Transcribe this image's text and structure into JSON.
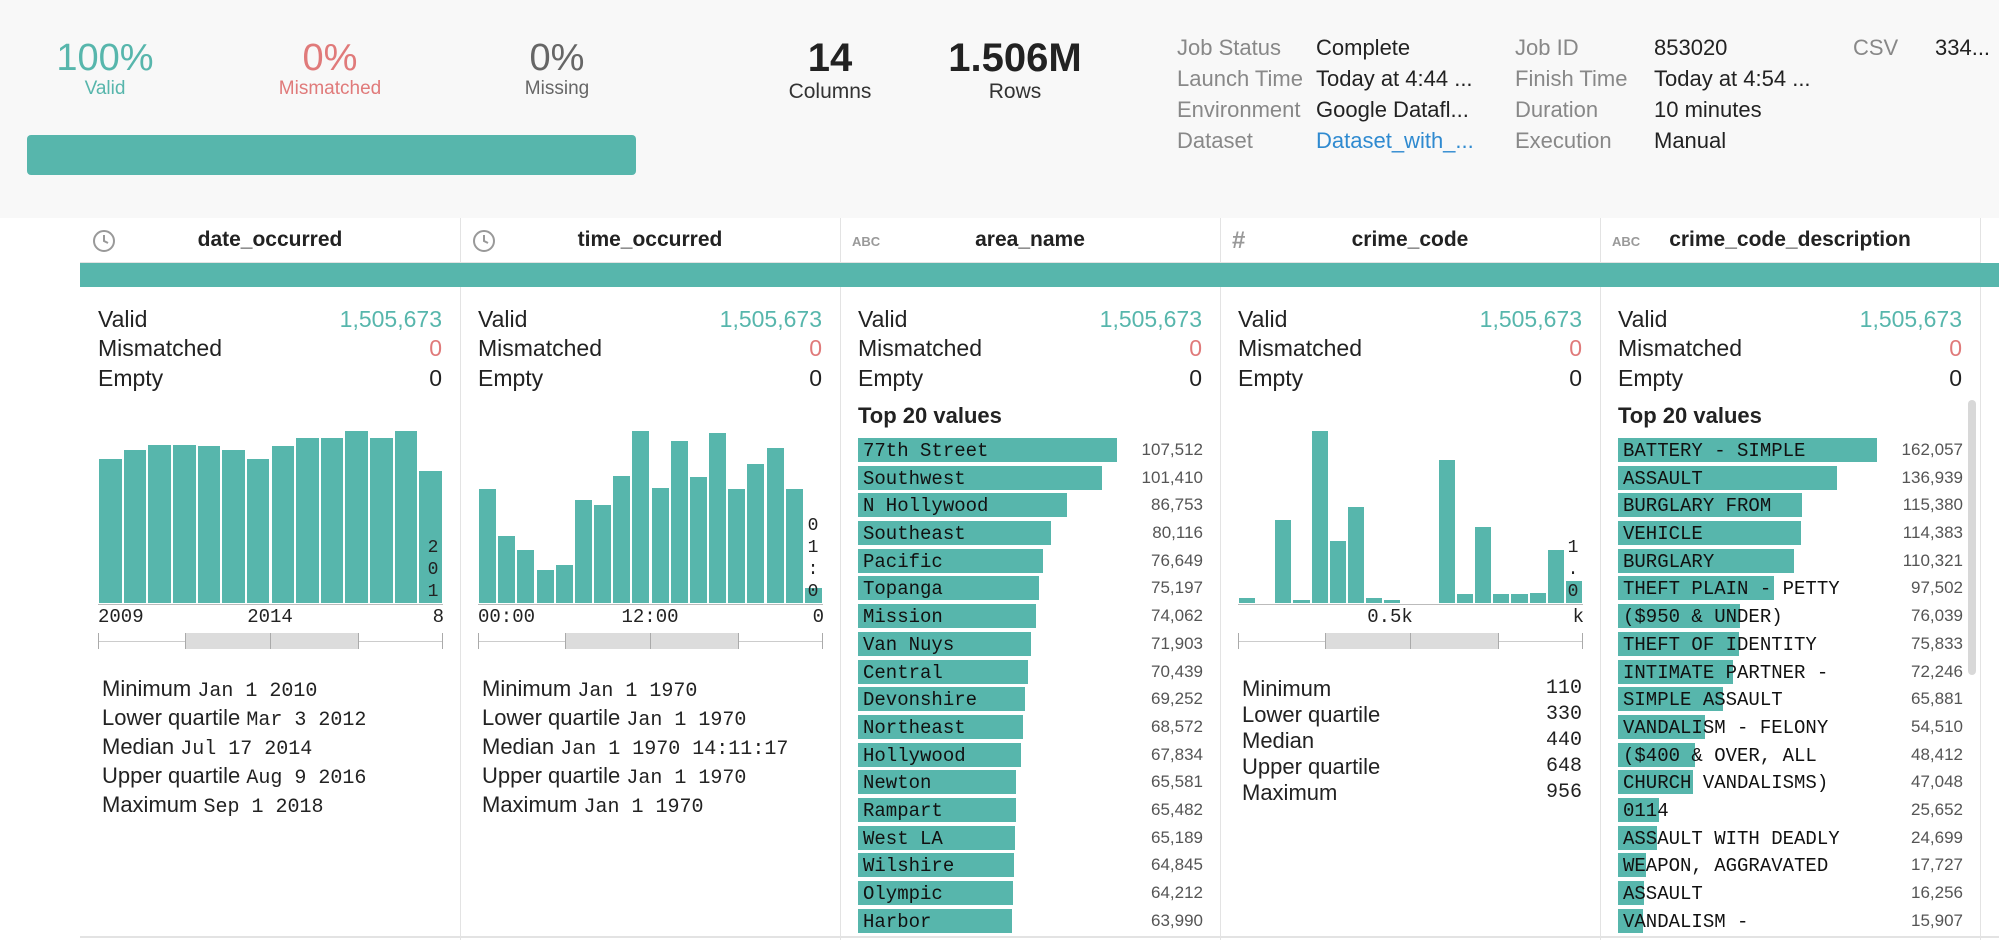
{
  "summary": {
    "valid": {
      "pct": "100%",
      "label": "Valid"
    },
    "mismatched": {
      "pct": "0%",
      "label": "Mismatched"
    },
    "missing": {
      "pct": "0%",
      "label": "Missing"
    },
    "valid_fraction": 1.0,
    "columns": {
      "value": "14",
      "label": "Columns"
    },
    "rows": {
      "value": "1.506M",
      "label": "Rows"
    }
  },
  "job": {
    "status_label": "Job Status",
    "status": "Complete",
    "launch_label": "Launch Time",
    "launch": "Today at 4:44 ...",
    "env_label": "Environment",
    "env": "Google Datafl...",
    "dataset_label": "Dataset",
    "dataset": "Dataset_with_...",
    "id_label": "Job ID",
    "id": "853020",
    "finish_label": "Finish Time",
    "finish": "Today at 4:54 ...",
    "duration_label": "Duration",
    "duration": "10 minutes",
    "execution_label": "Execution",
    "execution": "Manual",
    "csv_label": "CSV",
    "csv": "334..."
  },
  "labels": {
    "valid": "Valid",
    "mismatched": "Mismatched",
    "empty": "Empty",
    "top20": "Top 20 values",
    "min": "Minimum",
    "lq": "Lower quartile",
    "median": "Median",
    "uq": "Upper quartile",
    "max": "Maximum"
  },
  "columns": [
    {
      "name": "date_occurred",
      "type_icon": "clock-icon",
      "valid": "1,505,673",
      "mismatched": "0",
      "empty": "0",
      "hist": [
        0.84,
        0.89,
        0.92,
        0.92,
        0.91,
        0.89,
        0.84,
        0.91,
        0.96,
        0.96,
        1.0,
        0.96,
        1.0,
        0.77
      ],
      "ticks": [
        "2009",
        "2014",
        "8"
      ],
      "vlabel": [
        "2",
        "0",
        "1"
      ],
      "stats": {
        "min": "Jan 1 2010",
        "lq": "Mar 3 2012",
        "median": "Jul 17 2014",
        "uq": "Aug 9 2016",
        "max": "Sep 1 2018"
      }
    },
    {
      "name": "time_occurred",
      "type_icon": "clock-icon",
      "valid": "1,505,673",
      "mismatched": "0",
      "empty": "0",
      "hist": [
        0.66,
        0.39,
        0.31,
        0.19,
        0.22,
        0.6,
        0.57,
        0.74,
        1.0,
        0.67,
        0.94,
        0.73,
        0.99,
        0.66,
        0.81,
        0.9,
        0.66,
        0.09
      ],
      "ticks": [
        "00:00",
        "12:00",
        "0"
      ],
      "vlabel": [
        "0",
        "1",
        ":",
        "0"
      ],
      "stats": {
        "min": "Jan 1 1970",
        "lq": "Jan 1 1970",
        "median": "Jan 1 1970 14:11:17",
        "uq": "Jan 1 1970",
        "max": "Jan 1 1970"
      }
    },
    {
      "name": "area_name",
      "type_icon": "abc-icon",
      "valid": "1,505,673",
      "mismatched": "0",
      "empty": "0",
      "top": [
        [
          "77th Street",
          "107,512",
          107512
        ],
        [
          "Southwest",
          "101,410",
          101410
        ],
        [
          "N Hollywood",
          "86,753",
          86753
        ],
        [
          "Southeast",
          "80,116",
          80116
        ],
        [
          "Pacific",
          "76,649",
          76649
        ],
        [
          "Topanga",
          "75,197",
          75197
        ],
        [
          "Mission",
          "74,062",
          74062
        ],
        [
          "Van Nuys",
          "71,903",
          71903
        ],
        [
          "Central",
          "70,439",
          70439
        ],
        [
          "Devonshire",
          "69,252",
          69252
        ],
        [
          "Northeast",
          "68,572",
          68572
        ],
        [
          "Hollywood",
          "67,834",
          67834
        ],
        [
          "Newton",
          "65,581",
          65581
        ],
        [
          "Rampart",
          "65,482",
          65482
        ],
        [
          "West LA",
          "65,189",
          65189
        ],
        [
          "Wilshire",
          "64,845",
          64845
        ],
        [
          "Olympic",
          "64,212",
          64212
        ],
        [
          "Harbor",
          "63,990",
          63990
        ]
      ]
    },
    {
      "name": "crime_code",
      "type_icon": "hash-icon",
      "valid": "1,505,673",
      "mismatched": "0",
      "empty": "0",
      "hist": [
        0.03,
        0.0,
        0.48,
        0.02,
        1.0,
        0.36,
        0.56,
        0.03,
        0.02,
        0.0,
        0.0,
        0.83,
        0.05,
        0.44,
        0.05,
        0.05,
        0.06,
        0.31,
        0.13
      ],
      "ticks": [
        "0.5k",
        "k"
      ],
      "vlabel": [
        "1",
        ".",
        "0"
      ],
      "stats": {
        "min": "110",
        "lq": "330",
        "median": "440",
        "uq": "648",
        "max": "956"
      }
    },
    {
      "name": "crime_code_description",
      "type_icon": "abc-icon",
      "valid": "1,505,673",
      "mismatched": "0",
      "empty": "0",
      "top": [
        [
          "BATTERY - SIMPLE",
          "162,057",
          162057
        ],
        [
          "ASSAULT",
          "136,939",
          136939
        ],
        [
          "BURGLARY FROM",
          "115,380",
          115380
        ],
        [
          "VEHICLE",
          "114,383",
          114383
        ],
        [
          "BURGLARY",
          "110,321",
          110321
        ],
        [
          "THEFT PLAIN - PETTY",
          "97,502",
          97502
        ],
        [
          "($950 & UNDER)",
          "76,039",
          76039
        ],
        [
          "THEFT OF IDENTITY",
          "75,833",
          75833
        ],
        [
          "INTIMATE PARTNER -",
          "72,246",
          72246
        ],
        [
          "SIMPLE ASSAULT",
          "65,881",
          65881
        ],
        [
          "VANDALISM - FELONY",
          "54,510",
          54510
        ],
        [
          "($400 & OVER, ALL",
          "48,412",
          48412
        ],
        [
          "CHURCH VANDALISMS)",
          "47,048",
          47048
        ],
        [
          "0114",
          "25,652",
          25652
        ],
        [
          "ASSAULT WITH DEADLY",
          "24,699",
          24699
        ],
        [
          "WEAPON, AGGRAVATED",
          "17,727",
          17727
        ],
        [
          "ASSAULT",
          "16,256",
          16256
        ],
        [
          "VANDALISM -",
          "15,907",
          15907
        ]
      ]
    }
  ],
  "colors": {
    "accent": "#57b6ac",
    "mismatched": "#e07a7a",
    "link": "#2f8ad0"
  }
}
